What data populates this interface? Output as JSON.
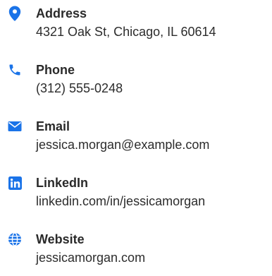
{
  "contact": {
    "accent_color": "#1a73e8",
    "items": [
      {
        "icon": "map-pin-icon",
        "label": "Address",
        "value": "4321 Oak St, Chicago, IL 60614"
      },
      {
        "icon": "phone-icon",
        "label": "Phone",
        "value": "(312) 555-0248"
      },
      {
        "icon": "envelope-icon",
        "label": "Email",
        "value": "jessica.morgan@example.com"
      },
      {
        "icon": "linkedin-icon",
        "label": "LinkedIn",
        "value": "linkedin.com/in/jessicamorgan"
      },
      {
        "icon": "globe-icon",
        "label": "Website",
        "value": "jessicamorgan.com"
      }
    ]
  }
}
